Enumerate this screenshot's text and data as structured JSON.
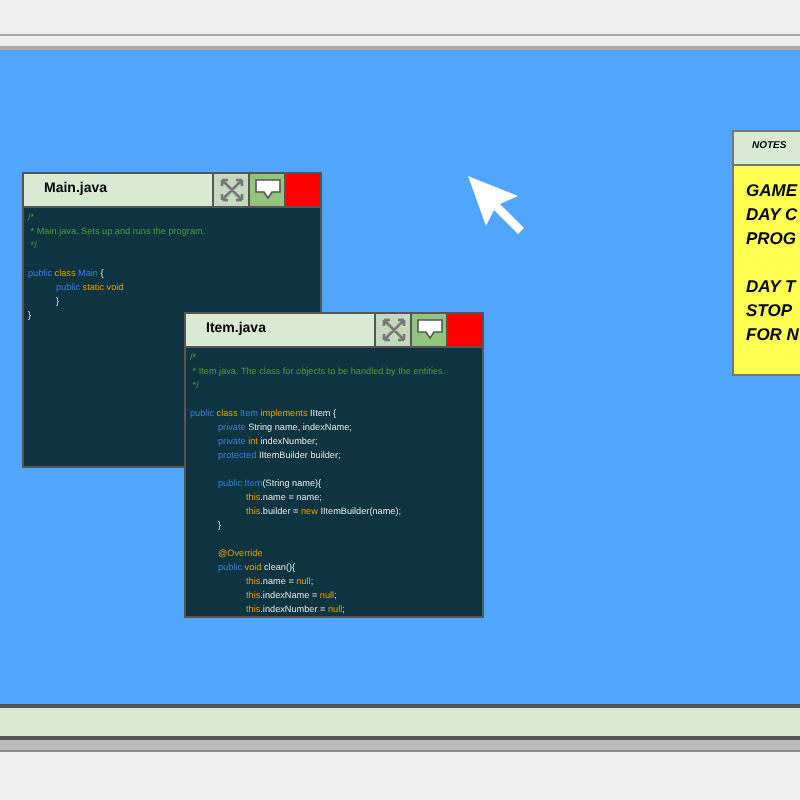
{
  "windows": [
    {
      "title": "Main.java",
      "lines": [
        {
          "kind": "flush",
          "tokens": [
            {
              "kind": "comment",
              "text": "/*"
            }
          ]
        },
        {
          "kind": "flush",
          "tokens": [
            {
              "kind": "comment",
              "text": " * Main.java. Sets up and runs the program."
            }
          ]
        },
        {
          "kind": "flush",
          "tokens": [
            {
              "kind": "comment",
              "text": " */"
            }
          ]
        },
        {
          "kind": "blank"
        },
        {
          "kind": "flush",
          "tokens": [
            {
              "kind": "keyword",
              "text": "public "
            },
            {
              "kind": "type",
              "text": "class "
            },
            {
              "kind": "keyword",
              "text": "Main"
            },
            {
              "kind": "plain",
              "text": " {"
            }
          ]
        },
        {
          "kind": "indent",
          "tokens": [
            {
              "kind": "keyword",
              "text": "public "
            },
            {
              "kind": "type",
              "text": "static void"
            }
          ]
        },
        {
          "kind": "indent",
          "tokens": [
            {
              "kind": "plain",
              "text": "}"
            }
          ]
        },
        {
          "kind": "flush",
          "tokens": [
            {
              "kind": "plain",
              "text": "}"
            }
          ]
        }
      ]
    },
    {
      "title": "Item.java",
      "lines": [
        {
          "kind": "flush",
          "tokens": [
            {
              "kind": "comment",
              "text": "/*"
            }
          ]
        },
        {
          "kind": "flush",
          "tokens": [
            {
              "kind": "comment",
              "text": " * Item.java. The class for objects to be handled by the entities."
            }
          ]
        },
        {
          "kind": "flush",
          "tokens": [
            {
              "kind": "comment",
              "text": " */"
            }
          ]
        },
        {
          "kind": "blank"
        },
        {
          "kind": "flush",
          "tokens": [
            {
              "kind": "keyword",
              "text": "public "
            },
            {
              "kind": "type",
              "text": "class "
            },
            {
              "kind": "keyword",
              "text": "Item "
            },
            {
              "kind": "type",
              "text": "implements "
            },
            {
              "kind": "plain",
              "text": "IItem {"
            }
          ]
        },
        {
          "kind": "indent",
          "tokens": [
            {
              "kind": "keyword",
              "text": "private "
            },
            {
              "kind": "plain",
              "text": "String name, indexName;"
            }
          ]
        },
        {
          "kind": "indent",
          "tokens": [
            {
              "kind": "keyword",
              "text": "private "
            },
            {
              "kind": "type",
              "text": "int "
            },
            {
              "kind": "plain",
              "text": "indexNumber;"
            }
          ]
        },
        {
          "kind": "indent",
          "tokens": [
            {
              "kind": "keyword",
              "text": "protected "
            },
            {
              "kind": "plain",
              "text": "IItemBuilder builder;"
            }
          ]
        },
        {
          "kind": "blank"
        },
        {
          "kind": "indent",
          "tokens": [
            {
              "kind": "keyword",
              "text": "public "
            },
            {
              "kind": "keyword",
              "text": "Item"
            },
            {
              "kind": "plain",
              "text": "(String name){"
            }
          ]
        },
        {
          "kind": "indent2",
          "tokens": [
            {
              "kind": "type",
              "text": "this"
            },
            {
              "kind": "plain",
              "text": ".name = name;"
            }
          ]
        },
        {
          "kind": "indent2",
          "tokens": [
            {
              "kind": "type",
              "text": "this"
            },
            {
              "kind": "plain",
              "text": ".builder = "
            },
            {
              "kind": "type",
              "text": "new "
            },
            {
              "kind": "plain",
              "text": "IItemBuilder(name);"
            }
          ]
        },
        {
          "kind": "indent",
          "tokens": [
            {
              "kind": "plain",
              "text": "}"
            }
          ]
        },
        {
          "kind": "blank"
        },
        {
          "kind": "indent",
          "tokens": [
            {
              "kind": "type",
              "text": "@Override"
            }
          ]
        },
        {
          "kind": "indent",
          "tokens": [
            {
              "kind": "keyword",
              "text": "public "
            },
            {
              "kind": "type",
              "text": "void "
            },
            {
              "kind": "plain",
              "text": "clean(){"
            }
          ]
        },
        {
          "kind": "indent2",
          "tokens": [
            {
              "kind": "type",
              "text": "this"
            },
            {
              "kind": "plain",
              "text": ".name = "
            },
            {
              "kind": "type",
              "text": "null"
            },
            {
              "kind": "plain",
              "text": ";"
            }
          ]
        },
        {
          "kind": "indent2",
          "tokens": [
            {
              "kind": "type",
              "text": "this"
            },
            {
              "kind": "plain",
              "text": ".indexName = "
            },
            {
              "kind": "type",
              "text": "null"
            },
            {
              "kind": "plain",
              "text": ";"
            }
          ]
        },
        {
          "kind": "indent2",
          "tokens": [
            {
              "kind": "type",
              "text": "this"
            },
            {
              "kind": "plain",
              "text": ".indexNumber = "
            },
            {
              "kind": "type",
              "text": "null"
            },
            {
              "kind": "plain",
              "text": ";"
            }
          ]
        }
      ]
    }
  ],
  "notes": {
    "title": "NOTES",
    "lines": [
      {
        "kind": "text",
        "text": "GAME"
      },
      {
        "kind": "text",
        "text": "DAY C"
      },
      {
        "kind": "text",
        "text": "PROG"
      },
      {
        "kind": "blank"
      },
      {
        "kind": "text",
        "text": "DAY T"
      },
      {
        "kind": "text",
        "text": "STOP"
      },
      {
        "kind": "text",
        "text": "FOR N"
      }
    ]
  }
}
